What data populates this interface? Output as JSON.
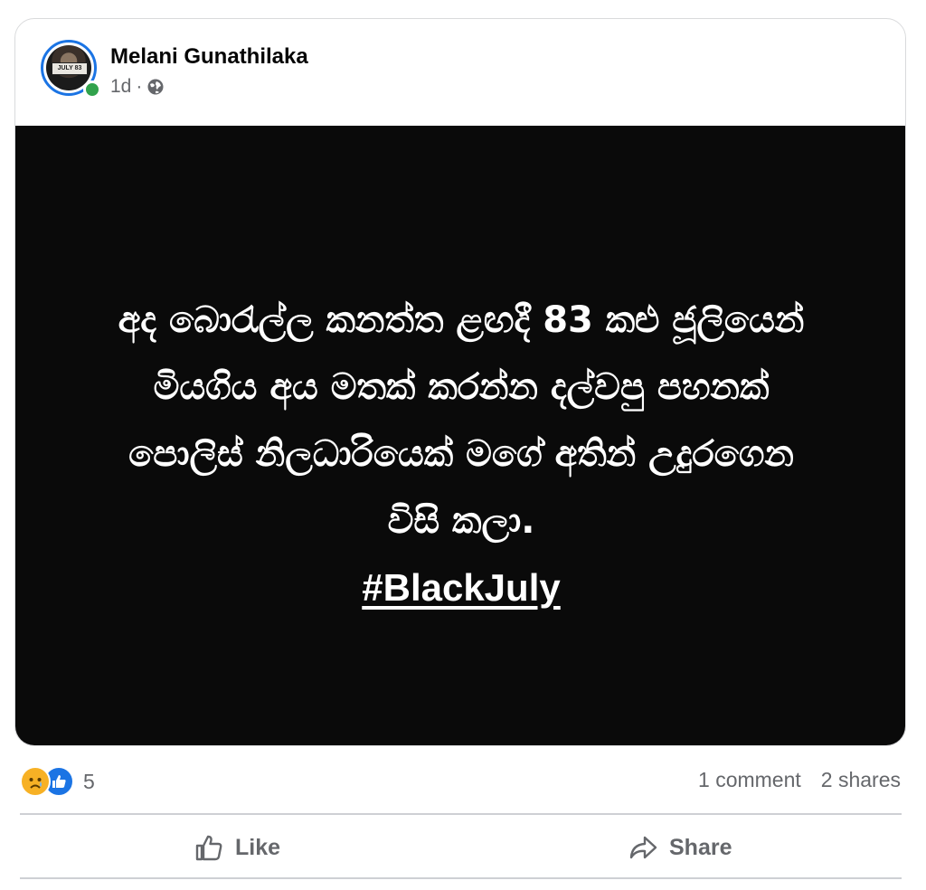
{
  "post": {
    "author": "Melani Gunathilaka",
    "timestamp": "1d",
    "separator": "·",
    "audience_icon": "globe-icon",
    "avatar_text": "JULY 83",
    "body_lines": [
      "අද බොරැල්ල කනත්ත ළඟදී 83 කළු ජූලියෙන්",
      "මියගිය අය මතක් කරන්න දල්වපු පහනක්",
      "පොලිස් නිලධාරියෙක් මගේ අතින් උදුරගෙන",
      "විසි කලා."
    ],
    "hashtag": "#BlackJuly"
  },
  "engagement": {
    "reaction_icons": [
      "sad-reaction-icon",
      "like-reaction-icon"
    ],
    "reaction_count": "5",
    "comments": "1 comment",
    "shares": "2 shares"
  },
  "actions": {
    "like_label": "Like",
    "share_label": "Share"
  },
  "colors": {
    "post_background": "#0a0a0a",
    "accent": "#1b74e4",
    "online": "#31a24c",
    "muted_text": "#65676b"
  }
}
